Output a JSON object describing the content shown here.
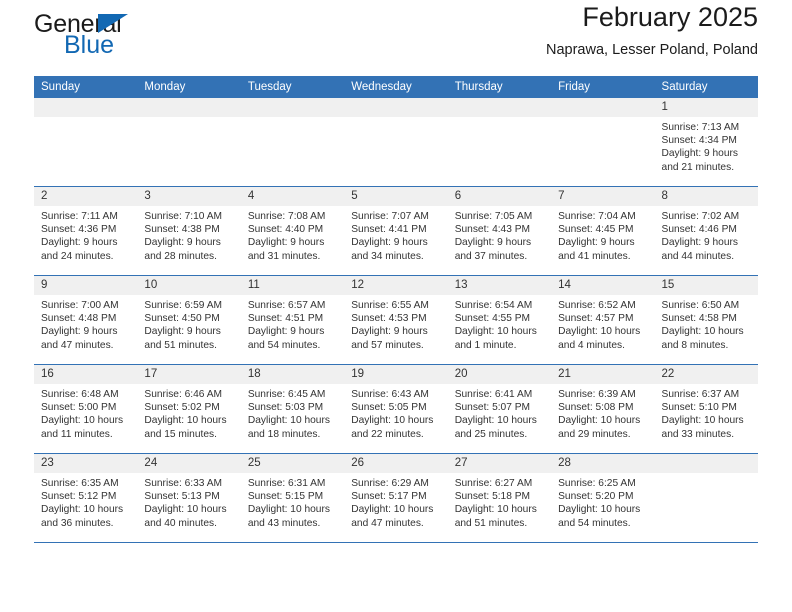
{
  "brand": {
    "name_top": "General",
    "name_bottom": "Blue",
    "triangle_color": "#1268b3",
    "accent_color": "#1268b3"
  },
  "header": {
    "title": "February 2025",
    "subtitle": "Naprawa, Lesser Poland, Poland",
    "header_bg": "#3372b5",
    "daynum_bg": "#f0f0f0"
  },
  "calendar": {
    "weekday_headers": [
      "Sunday",
      "Monday",
      "Tuesday",
      "Wednesday",
      "Thursday",
      "Friday",
      "Saturday"
    ],
    "weeks": [
      [
        {
          "empty": true
        },
        {
          "empty": true
        },
        {
          "empty": true
        },
        {
          "empty": true
        },
        {
          "empty": true
        },
        {
          "empty": true
        },
        {
          "day": "1",
          "sunrise": "Sunrise: 7:13 AM",
          "sunset": "Sunset: 4:34 PM",
          "daylight": "Daylight: 9 hours and 21 minutes."
        }
      ],
      [
        {
          "day": "2",
          "sunrise": "Sunrise: 7:11 AM",
          "sunset": "Sunset: 4:36 PM",
          "daylight": "Daylight: 9 hours and 24 minutes."
        },
        {
          "day": "3",
          "sunrise": "Sunrise: 7:10 AM",
          "sunset": "Sunset: 4:38 PM",
          "daylight": "Daylight: 9 hours and 28 minutes."
        },
        {
          "day": "4",
          "sunrise": "Sunrise: 7:08 AM",
          "sunset": "Sunset: 4:40 PM",
          "daylight": "Daylight: 9 hours and 31 minutes."
        },
        {
          "day": "5",
          "sunrise": "Sunrise: 7:07 AM",
          "sunset": "Sunset: 4:41 PM",
          "daylight": "Daylight: 9 hours and 34 minutes."
        },
        {
          "day": "6",
          "sunrise": "Sunrise: 7:05 AM",
          "sunset": "Sunset: 4:43 PM",
          "daylight": "Daylight: 9 hours and 37 minutes."
        },
        {
          "day": "7",
          "sunrise": "Sunrise: 7:04 AM",
          "sunset": "Sunset: 4:45 PM",
          "daylight": "Daylight: 9 hours and 41 minutes."
        },
        {
          "day": "8",
          "sunrise": "Sunrise: 7:02 AM",
          "sunset": "Sunset: 4:46 PM",
          "daylight": "Daylight: 9 hours and 44 minutes."
        }
      ],
      [
        {
          "day": "9",
          "sunrise": "Sunrise: 7:00 AM",
          "sunset": "Sunset: 4:48 PM",
          "daylight": "Daylight: 9 hours and 47 minutes."
        },
        {
          "day": "10",
          "sunrise": "Sunrise: 6:59 AM",
          "sunset": "Sunset: 4:50 PM",
          "daylight": "Daylight: 9 hours and 51 minutes."
        },
        {
          "day": "11",
          "sunrise": "Sunrise: 6:57 AM",
          "sunset": "Sunset: 4:51 PM",
          "daylight": "Daylight: 9 hours and 54 minutes."
        },
        {
          "day": "12",
          "sunrise": "Sunrise: 6:55 AM",
          "sunset": "Sunset: 4:53 PM",
          "daylight": "Daylight: 9 hours and 57 minutes."
        },
        {
          "day": "13",
          "sunrise": "Sunrise: 6:54 AM",
          "sunset": "Sunset: 4:55 PM",
          "daylight": "Daylight: 10 hours and 1 minute."
        },
        {
          "day": "14",
          "sunrise": "Sunrise: 6:52 AM",
          "sunset": "Sunset: 4:57 PM",
          "daylight": "Daylight: 10 hours and 4 minutes."
        },
        {
          "day": "15",
          "sunrise": "Sunrise: 6:50 AM",
          "sunset": "Sunset: 4:58 PM",
          "daylight": "Daylight: 10 hours and 8 minutes."
        }
      ],
      [
        {
          "day": "16",
          "sunrise": "Sunrise: 6:48 AM",
          "sunset": "Sunset: 5:00 PM",
          "daylight": "Daylight: 10 hours and 11 minutes."
        },
        {
          "day": "17",
          "sunrise": "Sunrise: 6:46 AM",
          "sunset": "Sunset: 5:02 PM",
          "daylight": "Daylight: 10 hours and 15 minutes."
        },
        {
          "day": "18",
          "sunrise": "Sunrise: 6:45 AM",
          "sunset": "Sunset: 5:03 PM",
          "daylight": "Daylight: 10 hours and 18 minutes."
        },
        {
          "day": "19",
          "sunrise": "Sunrise: 6:43 AM",
          "sunset": "Sunset: 5:05 PM",
          "daylight": "Daylight: 10 hours and 22 minutes."
        },
        {
          "day": "20",
          "sunrise": "Sunrise: 6:41 AM",
          "sunset": "Sunset: 5:07 PM",
          "daylight": "Daylight: 10 hours and 25 minutes."
        },
        {
          "day": "21",
          "sunrise": "Sunrise: 6:39 AM",
          "sunset": "Sunset: 5:08 PM",
          "daylight": "Daylight: 10 hours and 29 minutes."
        },
        {
          "day": "22",
          "sunrise": "Sunrise: 6:37 AM",
          "sunset": "Sunset: 5:10 PM",
          "daylight": "Daylight: 10 hours and 33 minutes."
        }
      ],
      [
        {
          "day": "23",
          "sunrise": "Sunrise: 6:35 AM",
          "sunset": "Sunset: 5:12 PM",
          "daylight": "Daylight: 10 hours and 36 minutes."
        },
        {
          "day": "24",
          "sunrise": "Sunrise: 6:33 AM",
          "sunset": "Sunset: 5:13 PM",
          "daylight": "Daylight: 10 hours and 40 minutes."
        },
        {
          "day": "25",
          "sunrise": "Sunrise: 6:31 AM",
          "sunset": "Sunset: 5:15 PM",
          "daylight": "Daylight: 10 hours and 43 minutes."
        },
        {
          "day": "26",
          "sunrise": "Sunrise: 6:29 AM",
          "sunset": "Sunset: 5:17 PM",
          "daylight": "Daylight: 10 hours and 47 minutes."
        },
        {
          "day": "27",
          "sunrise": "Sunrise: 6:27 AM",
          "sunset": "Sunset: 5:18 PM",
          "daylight": "Daylight: 10 hours and 51 minutes."
        },
        {
          "day": "28",
          "sunrise": "Sunrise: 6:25 AM",
          "sunset": "Sunset: 5:20 PM",
          "daylight": "Daylight: 10 hours and 54 minutes."
        },
        {
          "empty": true
        }
      ]
    ]
  }
}
